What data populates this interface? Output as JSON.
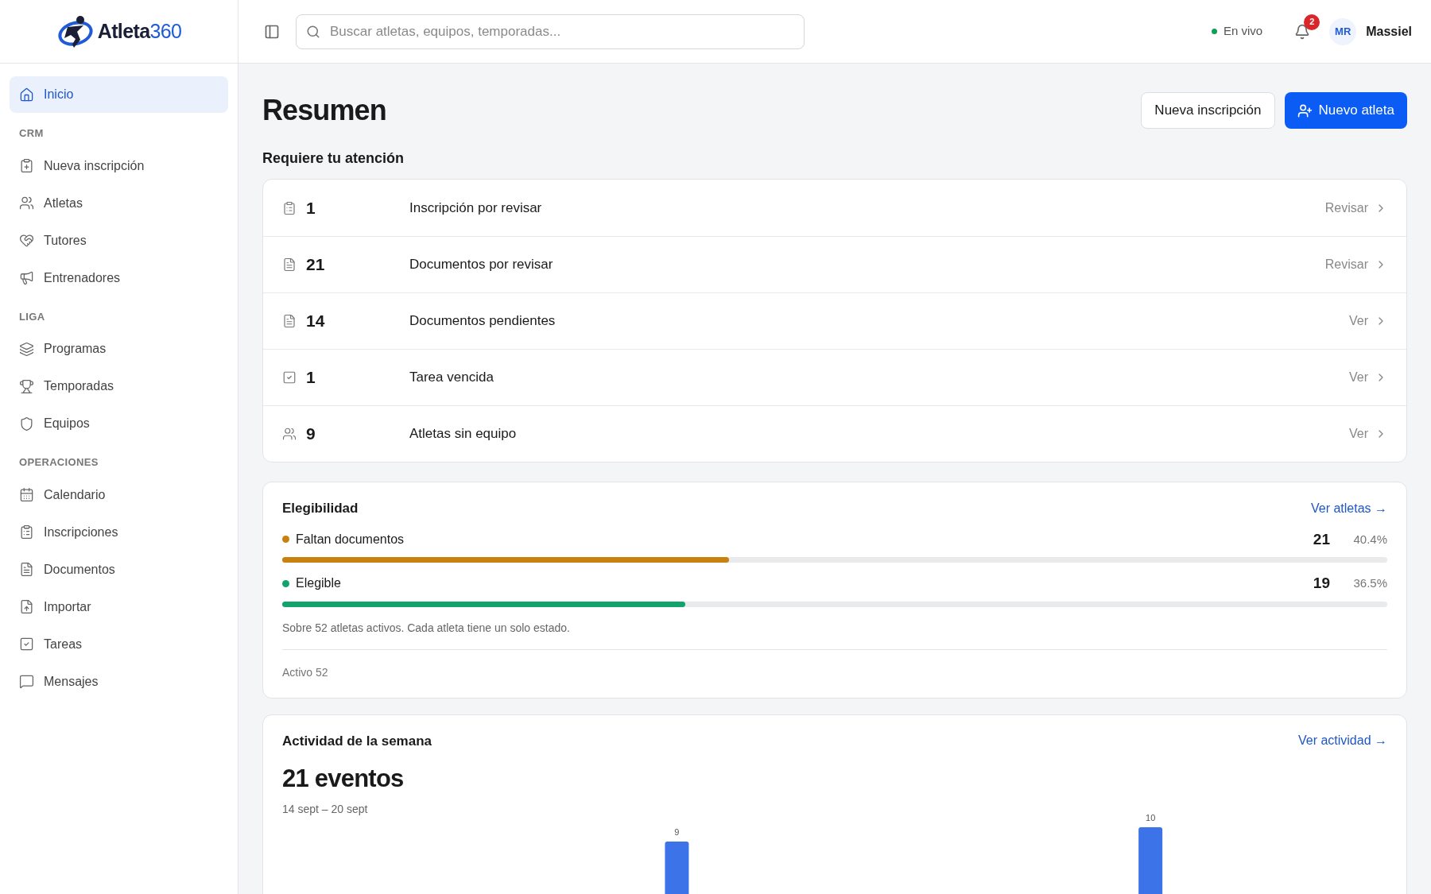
{
  "logo": {
    "name": "Atleta",
    "suffix": "360"
  },
  "search": {
    "placeholder": "Buscar atletas, equipos, temporadas..."
  },
  "status": {
    "label": "En vivo",
    "color": "#0f9d58"
  },
  "notifications": {
    "count": "2"
  },
  "user": {
    "initials": "MR",
    "name": "Massiel"
  },
  "sidebar": {
    "sections": [
      {
        "items": [
          {
            "label": "Inicio",
            "selected": true
          }
        ]
      },
      {
        "title": "CRM",
        "items": [
          {
            "label": "Nueva inscripción",
            "selected": false
          },
          {
            "label": "Atletas",
            "selected": false
          },
          {
            "label": "Tutores",
            "selected": false
          },
          {
            "label": "Entrenadores",
            "selected": false
          }
        ]
      },
      {
        "title": "LIGA",
        "items": [
          {
            "label": "Programas",
            "selected": false
          },
          {
            "label": "Temporadas",
            "selected": false
          },
          {
            "label": "Equipos",
            "selected": false
          }
        ]
      },
      {
        "title": "OPERACIONES",
        "items": [
          {
            "label": "Calendario",
            "selected": false
          },
          {
            "label": "Inscripciones",
            "selected": false
          },
          {
            "label": "Documentos",
            "selected": false
          },
          {
            "label": "Importar",
            "selected": false
          },
          {
            "label": "Tareas",
            "selected": false
          },
          {
            "label": "Mensajes",
            "selected": false
          }
        ]
      }
    ]
  },
  "page": {
    "title": "Resumen",
    "buttons": [
      {
        "label": "Nueva inscripción",
        "kind": "secondary"
      },
      {
        "label": "Nuevo atleta",
        "kind": "primary"
      }
    ]
  },
  "attention": {
    "title": "Requiere tu atención",
    "rows": [
      {
        "count": "1",
        "label": "Inscripción por revisar",
        "action": "Revisar"
      },
      {
        "count": "21",
        "label": "Documentos por revisar",
        "action": "Revisar"
      },
      {
        "count": "14",
        "label": "Documentos pendientes",
        "action": "Ver"
      },
      {
        "count": "1",
        "label": "Tarea vencida",
        "action": "Ver"
      },
      {
        "count": "9",
        "label": "Atletas sin equipo",
        "action": "Ver"
      }
    ]
  },
  "eligibility": {
    "title": "Elegibilidad",
    "link": "Ver atletas →",
    "items": [
      {
        "label": "Faltan documentos",
        "count": "21",
        "percent": "40.4%",
        "level": 0.404,
        "color": "#c8800f"
      },
      {
        "label": "Elegible",
        "count": "19",
        "percent": "36.5%",
        "level": 0.365,
        "color": "#11a36b"
      }
    ],
    "note": "Sobre 52 atletas activos. Cada atleta tiene un solo estado.",
    "footer": "Activo 52"
  },
  "activity": {
    "title": "Actividad de la semana",
    "link": "Ver actividad →",
    "total": "21 eventos",
    "range": "14 sept – 20 sept",
    "bar_labels": [
      "9",
      "10"
    ]
  }
}
